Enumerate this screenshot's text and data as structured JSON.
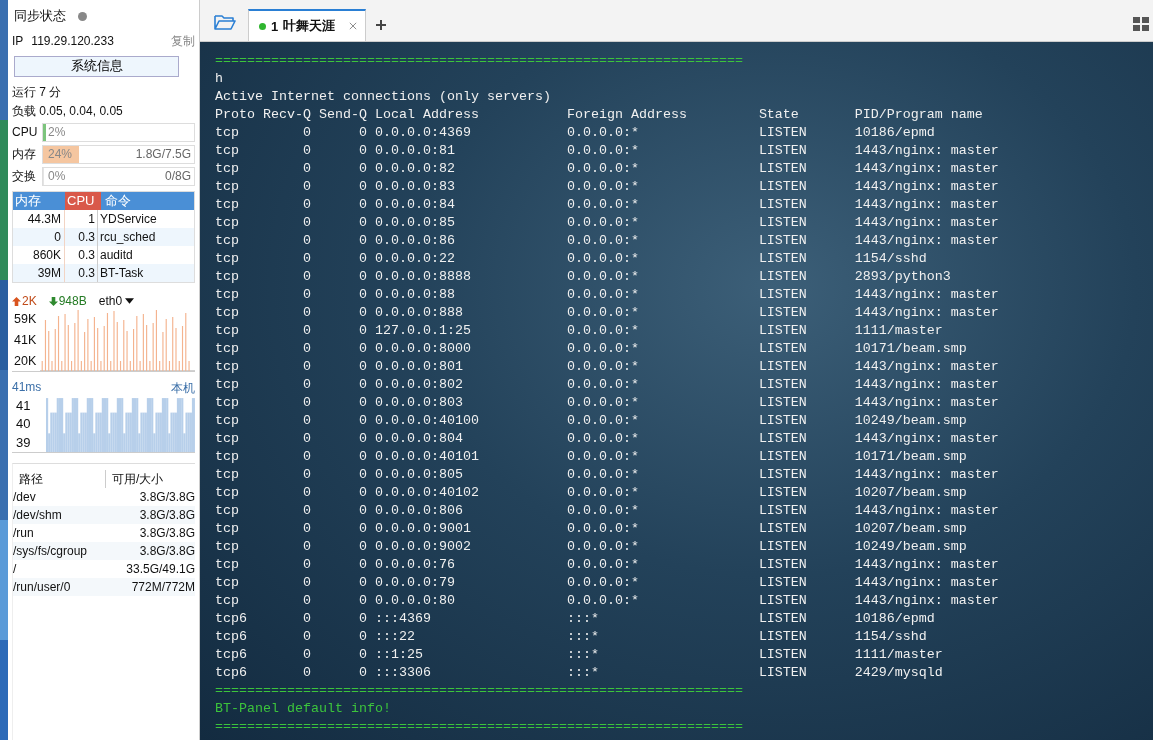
{
  "sidebar": {
    "sync": {
      "label": "同步状态",
      "online": false
    },
    "ip": {
      "label": "IP",
      "value": "119.29.120.233",
      "action": "复制"
    },
    "info_button": "系统信息",
    "uptime": "运行 7 分",
    "load": "负载 0.05, 0.04, 0.05",
    "meters": [
      {
        "label": "CPU",
        "reading": "2%",
        "level": 0.02,
        "color": "#7cc47c"
      },
      {
        "label": "内存",
        "reading": "24%",
        "detail": "1.8G/7.5G",
        "level": 0.24,
        "color": "#f5c6a0"
      },
      {
        "label": "交换",
        "reading": "0%",
        "detail": "0/8G",
        "level": 0
      }
    ],
    "processes": {
      "columns": [
        "内存",
        "CPU",
        "命令"
      ],
      "rows": [
        {
          "mem": "44.3M",
          "cpu": "1",
          "cmd": "YDService"
        },
        {
          "mem": "0",
          "cpu": "0.3",
          "cmd": "rcu_sched"
        },
        {
          "mem": "860K",
          "cpu": "0.3",
          "cmd": "auditd"
        },
        {
          "mem": "39M",
          "cpu": "0.3",
          "cmd": "BT-Task"
        }
      ]
    },
    "network": {
      "up": "2K",
      "down": "948B",
      "interface": "eth0",
      "axis_labels": [
        "59K",
        "41K",
        "20K"
      ]
    },
    "ping": {
      "latency": "41ms",
      "target": "本机",
      "axis_labels": [
        "41",
        "40",
        "39"
      ]
    },
    "disks": {
      "columns": [
        "路径",
        "可用/大小"
      ],
      "rows": [
        {
          "path": "/dev",
          "usage": "3.8G/3.8G"
        },
        {
          "path": "/dev/shm",
          "usage": "3.8G/3.8G"
        },
        {
          "path": "/run",
          "usage": "3.8G/3.8G"
        },
        {
          "path": "/sys/fs/cgroup",
          "usage": "3.8G/3.8G"
        },
        {
          "path": "/",
          "usage": "33.5G/49.1G"
        },
        {
          "path": "/run/user/0",
          "usage": "772M/772M"
        }
      ]
    }
  },
  "tabs": [
    {
      "number": "1",
      "label": "叶舞天涯",
      "selected": true,
      "connected": true
    }
  ],
  "terminal": {
    "lines": [
      {
        "kind": "rule",
        "text": "=================================================================="
      },
      {
        "kind": "text",
        "text": "h"
      },
      {
        "kind": "text",
        "text": "Active Internet connections (only servers)"
      },
      {
        "kind": "text",
        "text": "Proto Recv-Q Send-Q Local Address           Foreign Address         State       PID/Program name"
      },
      {
        "kind": "text",
        "text": "tcp        0      0 0.0.0.0:4369            0.0.0.0:*               LISTEN      10186/epmd"
      },
      {
        "kind": "text",
        "text": "tcp        0      0 0.0.0.0:81              0.0.0.0:*               LISTEN      1443/nginx: master"
      },
      {
        "kind": "text",
        "text": "tcp        0      0 0.0.0.0:82              0.0.0.0:*               LISTEN      1443/nginx: master"
      },
      {
        "kind": "text",
        "text": "tcp        0      0 0.0.0.0:83              0.0.0.0:*               LISTEN      1443/nginx: master"
      },
      {
        "kind": "text",
        "text": "tcp        0      0 0.0.0.0:84              0.0.0.0:*               LISTEN      1443/nginx: master"
      },
      {
        "kind": "text",
        "text": "tcp        0      0 0.0.0.0:85              0.0.0.0:*               LISTEN      1443/nginx: master"
      },
      {
        "kind": "text",
        "text": "tcp        0      0 0.0.0.0:86              0.0.0.0:*               LISTEN      1443/nginx: master"
      },
      {
        "kind": "text",
        "text": "tcp        0      0 0.0.0.0:22              0.0.0.0:*               LISTEN      1154/sshd"
      },
      {
        "kind": "text",
        "text": "tcp        0      0 0.0.0.0:8888            0.0.0.0:*               LISTEN      2893/python3"
      },
      {
        "kind": "text",
        "text": "tcp        0      0 0.0.0.0:88              0.0.0.0:*               LISTEN      1443/nginx: master"
      },
      {
        "kind": "text",
        "text": "tcp        0      0 0.0.0.0:888             0.0.0.0:*               LISTEN      1443/nginx: master"
      },
      {
        "kind": "text",
        "text": "tcp        0      0 127.0.0.1:25            0.0.0.0:*               LISTEN      1111/master"
      },
      {
        "kind": "text",
        "text": "tcp        0      0 0.0.0.0:8000            0.0.0.0:*               LISTEN      10171/beam.smp"
      },
      {
        "kind": "text",
        "text": "tcp        0      0 0.0.0.0:801             0.0.0.0:*               LISTEN      1443/nginx: master"
      },
      {
        "kind": "text",
        "text": "tcp        0      0 0.0.0.0:802             0.0.0.0:*               LISTEN      1443/nginx: master"
      },
      {
        "kind": "text",
        "text": "tcp        0      0 0.0.0.0:803             0.0.0.0:*               LISTEN      1443/nginx: master"
      },
      {
        "kind": "text",
        "text": "tcp        0      0 0.0.0.0:40100           0.0.0.0:*               LISTEN      10249/beam.smp"
      },
      {
        "kind": "text",
        "text": "tcp        0      0 0.0.0.0:804             0.0.0.0:*               LISTEN      1443/nginx: master"
      },
      {
        "kind": "text",
        "text": "tcp        0      0 0.0.0.0:40101           0.0.0.0:*               LISTEN      10171/beam.smp"
      },
      {
        "kind": "text",
        "text": "tcp        0      0 0.0.0.0:805             0.0.0.0:*               LISTEN      1443/nginx: master"
      },
      {
        "kind": "text",
        "text": "tcp        0      0 0.0.0.0:40102           0.0.0.0:*               LISTEN      10207/beam.smp"
      },
      {
        "kind": "text",
        "text": "tcp        0      0 0.0.0.0:806             0.0.0.0:*               LISTEN      1443/nginx: master"
      },
      {
        "kind": "text",
        "text": "tcp        0      0 0.0.0.0:9001            0.0.0.0:*               LISTEN      10207/beam.smp"
      },
      {
        "kind": "text",
        "text": "tcp        0      0 0.0.0.0:9002            0.0.0.0:*               LISTEN      10249/beam.smp"
      },
      {
        "kind": "text",
        "text": "tcp        0      0 0.0.0.0:76              0.0.0.0:*               LISTEN      1443/nginx: master"
      },
      {
        "kind": "text",
        "text": "tcp        0      0 0.0.0.0:79              0.0.0.0:*               LISTEN      1443/nginx: master"
      },
      {
        "kind": "text",
        "text": "tcp        0      0 0.0.0.0:80              0.0.0.0:*               LISTEN      1443/nginx: master"
      },
      {
        "kind": "text",
        "text": "tcp6       0      0 :::4369                 :::*                    LISTEN      10186/epmd"
      },
      {
        "kind": "text",
        "text": "tcp6       0      0 :::22                   :::*                    LISTEN      1154/sshd"
      },
      {
        "kind": "text",
        "text": "tcp6       0      0 ::1:25                  :::*                    LISTEN      1111/master"
      },
      {
        "kind": "text",
        "text": "tcp6       0      0 :::3306                 :::*                    LISTEN      2429/mysqld"
      },
      {
        "kind": "rule",
        "text": "=================================================================="
      },
      {
        "kind": "notice",
        "text": "BT-Panel default info!"
      },
      {
        "kind": "rule",
        "text": "=================================================================="
      }
    ]
  }
}
